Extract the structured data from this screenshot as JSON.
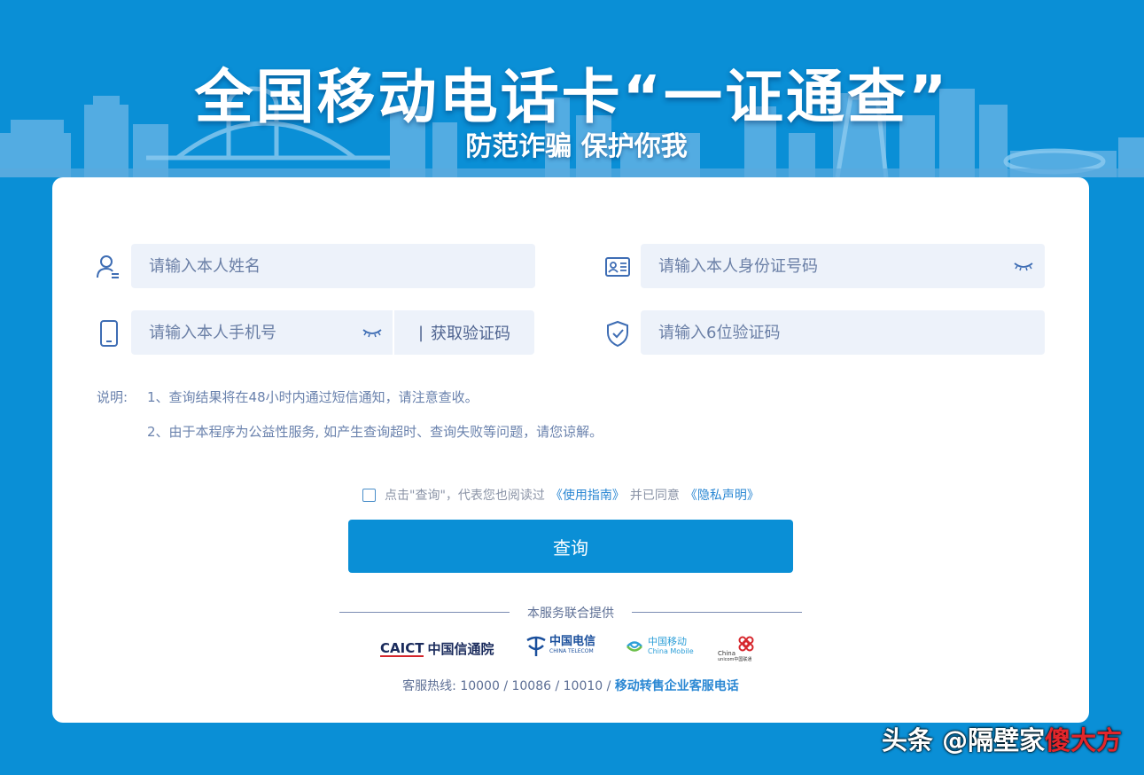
{
  "hero": {
    "title": "全国移动电话卡“一证通查”",
    "subtitle": "防范诈骗 保护你我"
  },
  "form": {
    "name_placeholder": "请输入本人姓名",
    "id_placeholder": "请输入本人身份证号码",
    "phone_placeholder": "请输入本人手机号",
    "get_code_separator": "|",
    "get_code_label": "获取验证码",
    "code_placeholder": "请输入6位验证码"
  },
  "notes": {
    "label": "说明:",
    "line1": "1、查询结果将在48小时内通过短信通知，请注意查收。",
    "line2": "2、由于本程序为公益性服务, 如产生查询超时、查询失败等问题，请您谅解。"
  },
  "agreement": {
    "prefix": "点击\"查询\"，代表您也阅读过",
    "guide_link": "《使用指南》",
    "middle": "并已同意",
    "privacy_link": "《隐私声明》"
  },
  "query_button": "查询",
  "providers": {
    "heading": "本服务联合提供",
    "caict_mark": "CAICT",
    "caict_name": "中国信通院",
    "telecom_name": "中国电信",
    "telecom_en": "CHINA TELECOM",
    "mobile_name": "中国移动",
    "mobile_en": "China Mobile",
    "unicom_en": "China",
    "unicom_sub": "unicom中国联通"
  },
  "hotline": {
    "prefix": "客服热线: 10000 / 10086 / 10010 /",
    "link": "移动转售企业客服电话"
  },
  "watermark": {
    "text": "头条 @隔壁家",
    "stamp": "傻大方"
  },
  "colors": {
    "brand_blue": "#0a8fd6",
    "field_bg": "#edf2fa",
    "link_blue": "#2a87d3"
  }
}
